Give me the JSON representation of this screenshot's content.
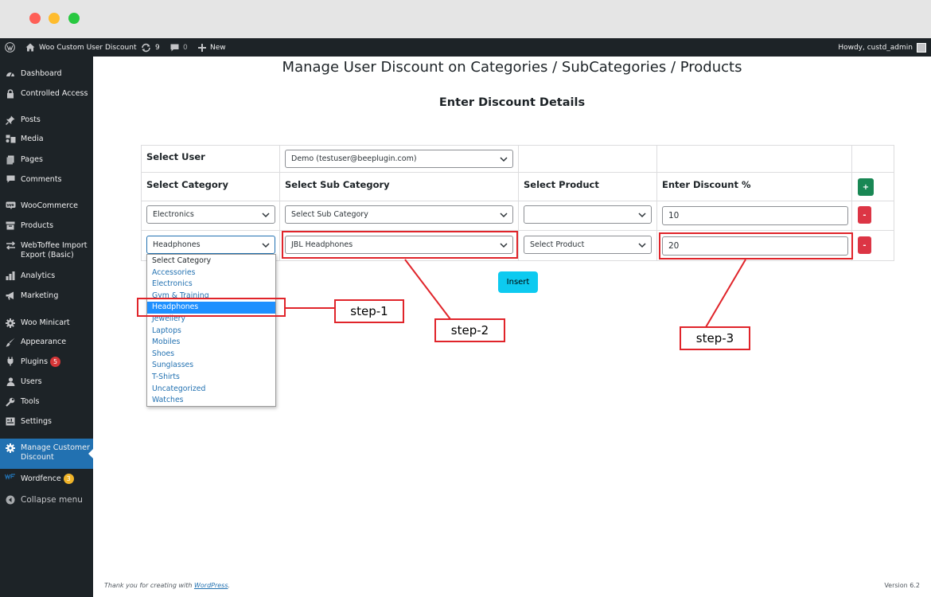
{
  "window": {
    "dots": [
      "#fe5f57",
      "#febc2e",
      "#28c840"
    ]
  },
  "adminbar": {
    "site_name": "Woo Custom User Discount",
    "updates_count": "9",
    "comments_count": "0",
    "new_label": "New",
    "greeting": "Howdy, custd_admin"
  },
  "sidebar": {
    "items": [
      {
        "label": "Dashboard",
        "icon": "dashboard-icon"
      },
      {
        "label": "Controlled Access",
        "icon": "lock-icon"
      },
      {
        "label": "Posts",
        "icon": "pin-icon"
      },
      {
        "label": "Media",
        "icon": "media-icon"
      },
      {
        "label": "Pages",
        "icon": "pages-icon"
      },
      {
        "label": "Comments",
        "icon": "comment-icon"
      },
      {
        "label": "WooCommerce",
        "icon": "woocommerce-icon"
      },
      {
        "label": "Products",
        "icon": "products-icon"
      },
      {
        "label": "WebToffee Import Export (Basic)",
        "icon": "import-export-icon"
      },
      {
        "label": "Analytics",
        "icon": "chart-icon"
      },
      {
        "label": "Marketing",
        "icon": "megaphone-icon"
      },
      {
        "label": "Woo Minicart",
        "icon": "gear-icon"
      },
      {
        "label": "Appearance",
        "icon": "brush-icon"
      },
      {
        "label": "Plugins",
        "icon": "plugin-icon",
        "badge": "5"
      },
      {
        "label": "Users",
        "icon": "user-icon"
      },
      {
        "label": "Tools",
        "icon": "wrench-icon"
      },
      {
        "label": "Settings",
        "icon": "settings-icon"
      },
      {
        "label": "Manage Customer Discount",
        "icon": "gear-icon"
      },
      {
        "label": "Wordfence",
        "icon": "wordfence-icon",
        "badge": "3"
      },
      {
        "label": "Collapse menu",
        "icon": "collapse-icon"
      }
    ]
  },
  "main": {
    "title": "Manage User Discount on Categories / SubCategories / Products",
    "subtitle": "Enter Discount Details",
    "select_user_label": "Select User",
    "select_user_value": "Demo (testuser@beeplugin.com)",
    "headers": {
      "category": "Select Category",
      "subcategory": "Select Sub Category",
      "product": "Select Product",
      "discount": "Enter Discount %"
    },
    "rows": [
      {
        "category": "Electronics",
        "subcategory": "Select Sub Category",
        "product": "",
        "discount": "10"
      },
      {
        "category": "Headphones",
        "subcategory": "JBL Headphones",
        "product": "Select Product",
        "discount": "20"
      }
    ],
    "add_button": "+",
    "remove_button": "-",
    "insert_button": "Insert"
  },
  "category_dropdown": {
    "options": [
      "Select Category",
      "Accessories",
      "Electronics",
      "Gym & Training",
      "Headphones",
      "Jewellery",
      "Laptops",
      "Mobiles",
      "Shoes",
      "Sunglasses",
      "T-Shirts",
      "Uncategorized",
      "Watches"
    ],
    "selected": "Headphones"
  },
  "annotations": {
    "step1": "step-1",
    "step2": "step-2",
    "step3": "step-3"
  },
  "footer": {
    "thanks_prefix": "Thank you for creating with ",
    "thanks_link": "WordPress",
    "thanks_suffix": ".",
    "version": "Version 6.2"
  },
  "colors": {
    "accent": "#2271b1",
    "annotation": "#e0242a",
    "add": "#198754",
    "remove": "#dc3545",
    "insert": "#0dcaf0"
  }
}
